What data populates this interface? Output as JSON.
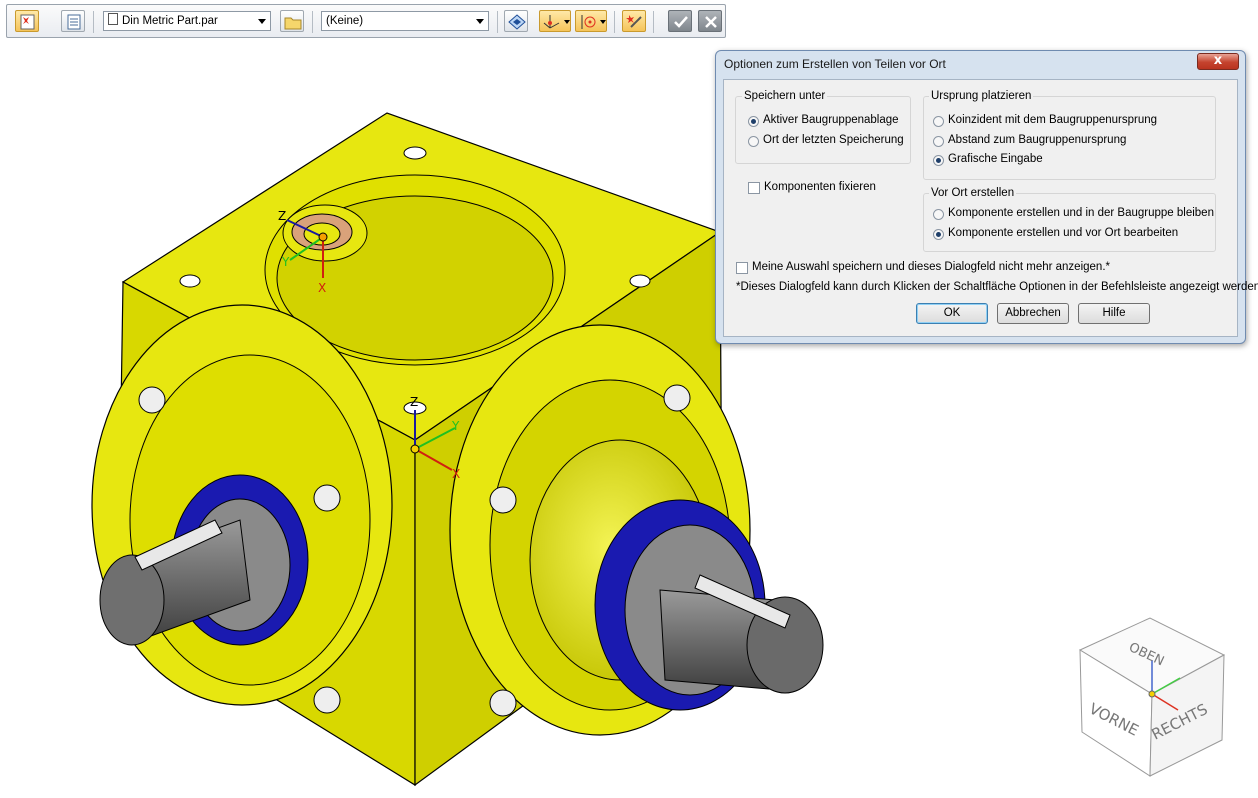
{
  "commandbar": {
    "part_template": "Din Metric Part.par",
    "material": "(Keine)",
    "buttons": [
      "create-in-place",
      "options",
      "browse-folder",
      "plane-lock",
      "coordinate-system",
      "origin",
      "scribble",
      "accept",
      "cancel"
    ]
  },
  "dialog": {
    "title": "Optionen zum Erstellen von Teilen vor Ort",
    "close_label": "x",
    "save_under": {
      "label": "Speichern unter",
      "options": [
        "Aktiver Baugruppenablage",
        "Ort der letzten Speicherung"
      ],
      "selected": 0
    },
    "origin": {
      "label": "Ursprung platzieren",
      "options": [
        "Koinzident mit dem Baugruppenursprung",
        "Abstand zum Baugruppenursprung",
        "Grafische Eingabe"
      ],
      "selected": 2
    },
    "fix_components": {
      "label": "Komponenten fixieren",
      "checked": false
    },
    "create_in_place": {
      "label": "Vor Ort erstellen",
      "options": [
        "Komponente erstellen und in der Baugruppe bleiben",
        "Komponente erstellen und vor Ort bearbeiten"
      ],
      "selected": 1
    },
    "remember": {
      "label": "Meine Auswahl speichern und dieses Dialogfeld nicht mehr anzeigen.*",
      "checked": false
    },
    "note": "*Dieses Dialogfeld kann durch Klicken der Schaltfläche Optionen in der Befehlsleiste angezeigt werden.",
    "buttons": {
      "ok": "OK",
      "cancel": "Abbrechen",
      "help": "Hilfe"
    }
  },
  "viewport": {
    "triad_axes": [
      "Z",
      "Y",
      "X"
    ],
    "view_cube": {
      "top": "OBEN",
      "front": "VORNE",
      "right": "RECHTS"
    },
    "colors": {
      "housing": "#e6e600",
      "seal": "#1a1ab0",
      "shaft": "#707070"
    }
  }
}
